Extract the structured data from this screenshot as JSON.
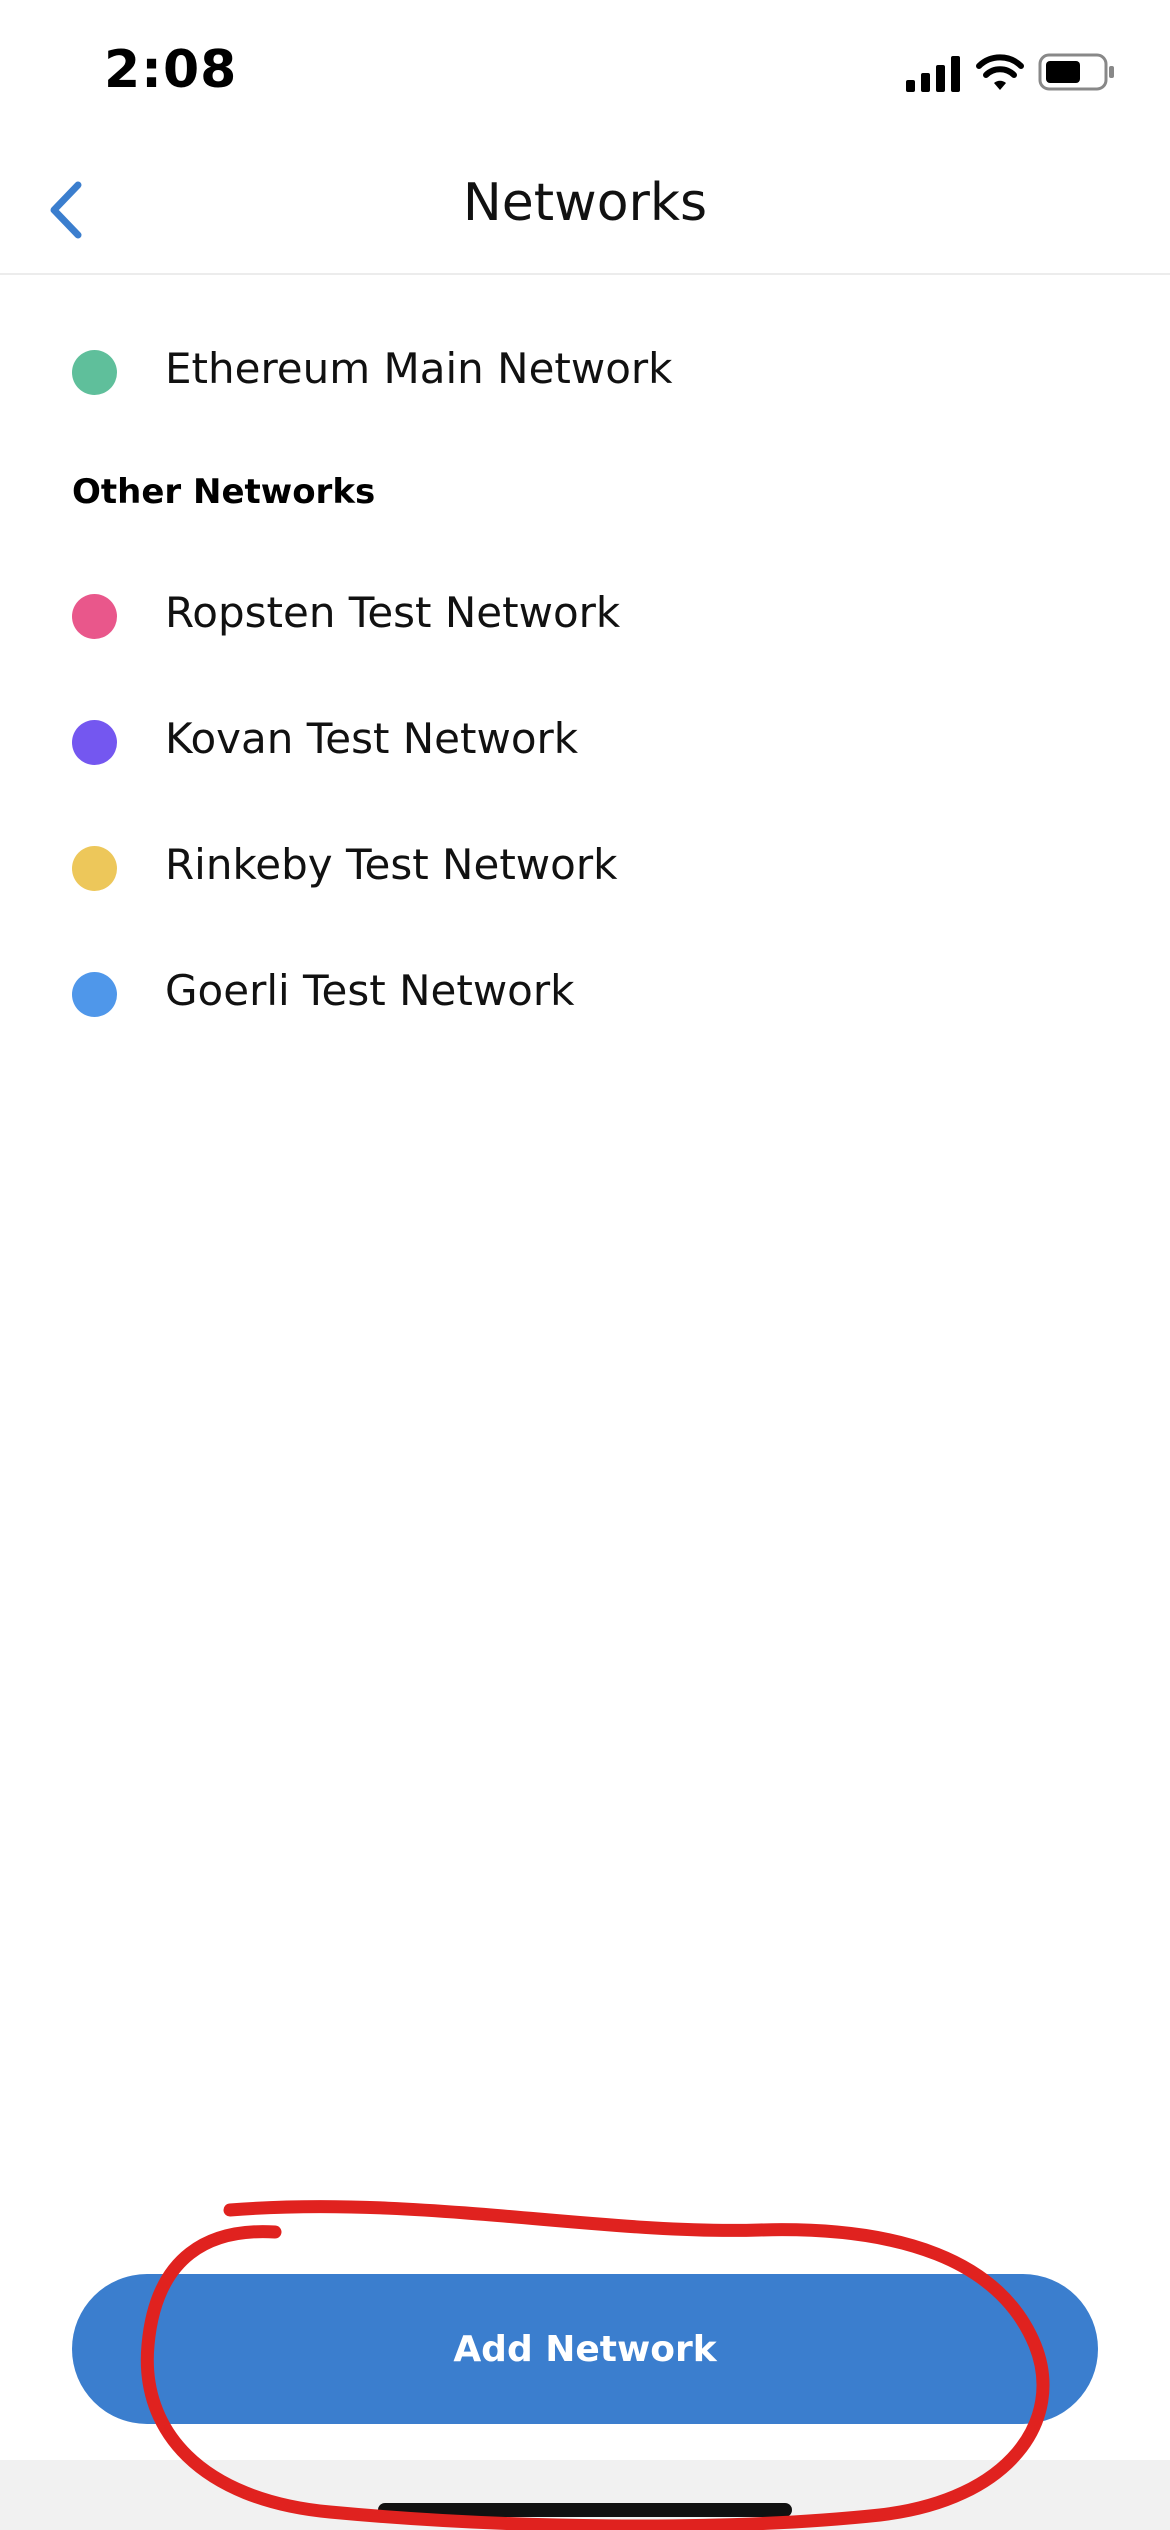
{
  "status_bar": {
    "time": "2:08",
    "icons": [
      "signal-icon",
      "wifi-icon",
      "battery-icon"
    ]
  },
  "header": {
    "title": "Networks",
    "back_icon": "chevron-left-icon"
  },
  "main_network": {
    "label": "Ethereum Main Network",
    "color": "#5fbf9b"
  },
  "other_networks": {
    "heading": "Other Networks",
    "items": [
      {
        "label": "Ropsten Test Network",
        "color": "#e9578b"
      },
      {
        "label": "Kovan Test Network",
        "color": "#7457f0"
      },
      {
        "label": "Rinkeby Test Network",
        "color": "#edc75a"
      },
      {
        "label": "Goerli Test Network",
        "color": "#4f97ea"
      }
    ]
  },
  "actions": {
    "add_network_label": "Add Network"
  },
  "colors": {
    "accent": "#3b7ece",
    "annotation": "#e0221f"
  }
}
